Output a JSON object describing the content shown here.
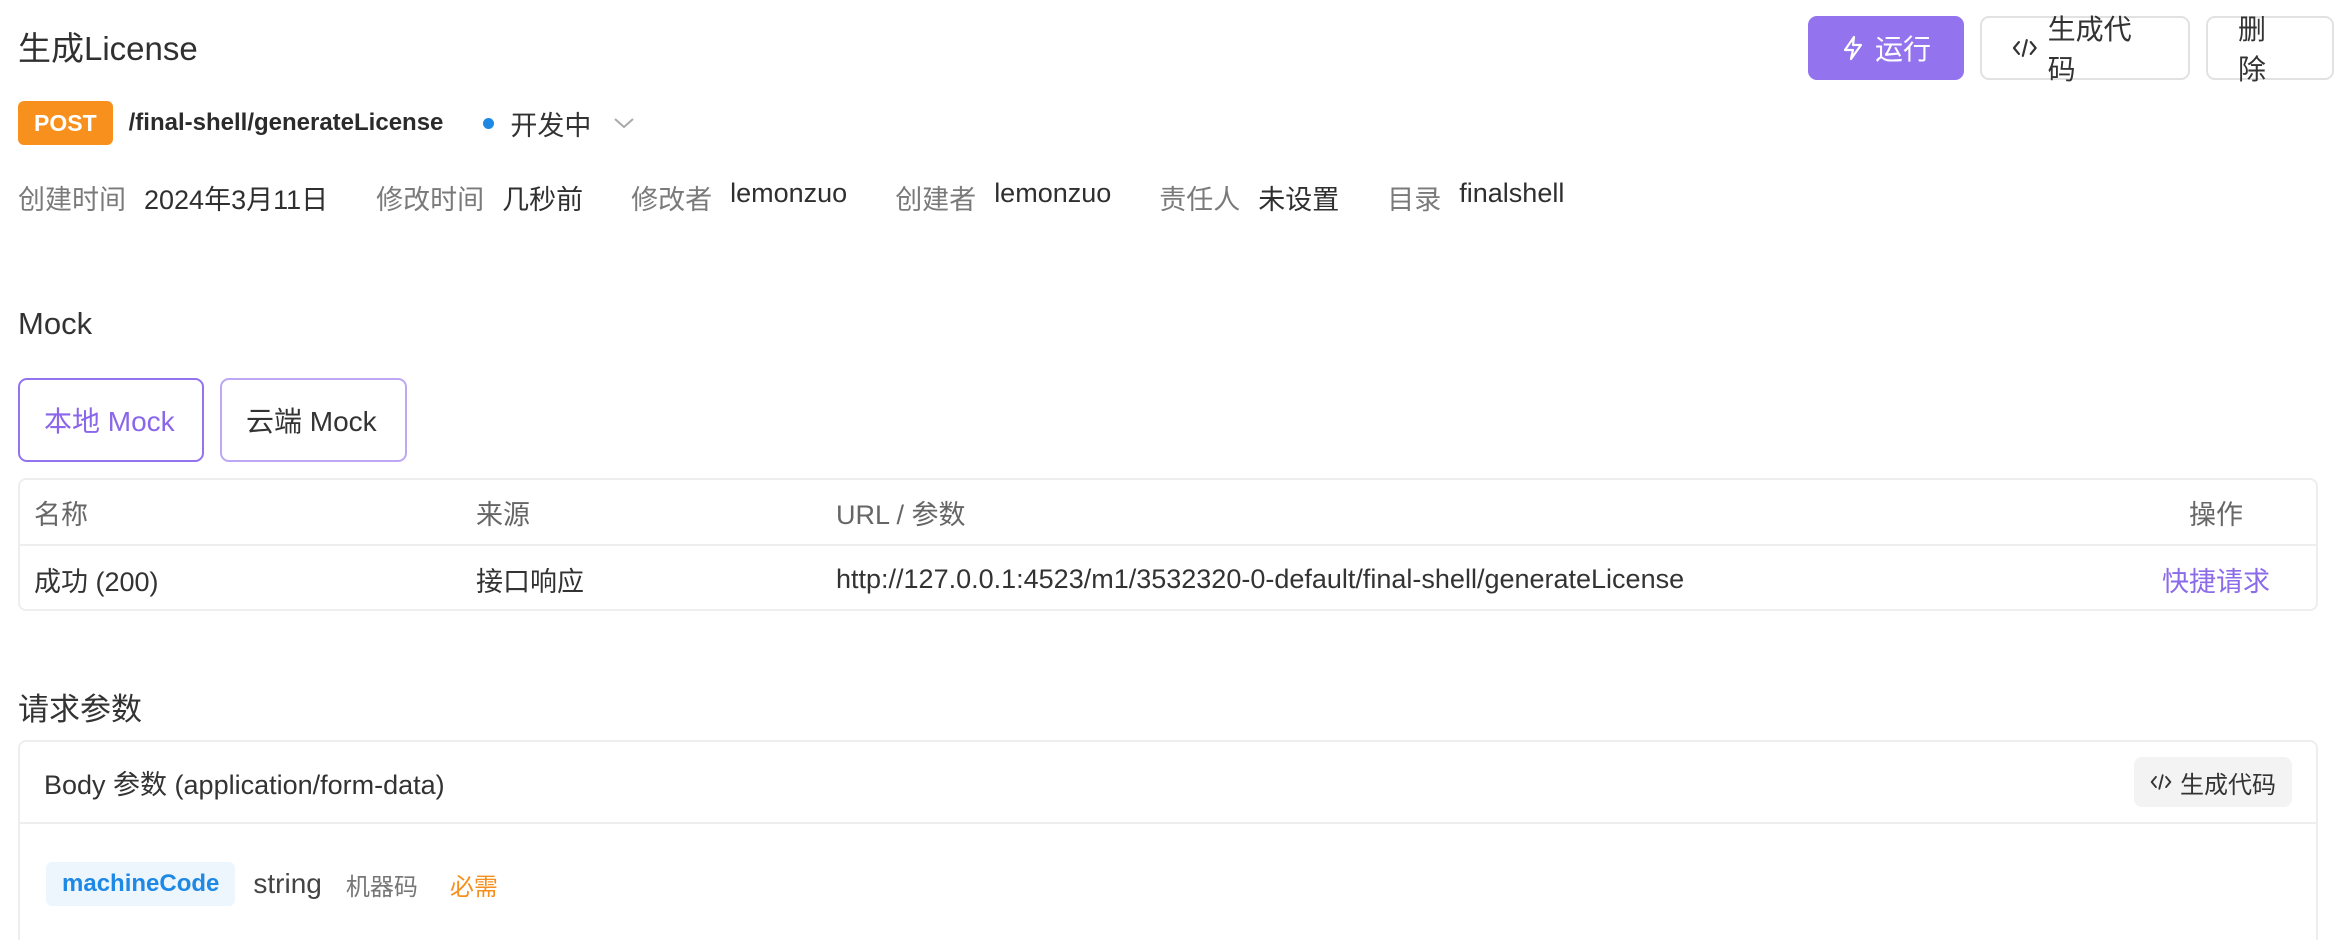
{
  "header": {
    "title": "生成License",
    "run_label": "运行",
    "gen_code_label": "生成代码",
    "delete_label": "删 除",
    "method": "POST",
    "path": "/final-shell/generateLicense",
    "status": "开发中"
  },
  "info": [
    {
      "label": "创建时间",
      "value": "2024年3月11日"
    },
    {
      "label": "修改时间",
      "value": "几秒前"
    },
    {
      "label": "修改者",
      "value": "lemonzuo"
    },
    {
      "label": "创建者",
      "value": "lemonzuo"
    },
    {
      "label": "责任人",
      "value": "未设置"
    },
    {
      "label": "目录",
      "value": "finalshell"
    }
  ],
  "mock": {
    "title": "Mock",
    "local_label": "本地 Mock",
    "cloud_label": "云端 Mock",
    "table": {
      "headers": [
        "名称",
        "来源",
        "URL / 参数",
        "操作"
      ],
      "row": {
        "name": "成功 (200)",
        "source": "接口响应",
        "url": "http://127.0.0.1:4523/m1/3532320-0-default/final-shell/generateLicense",
        "action": "快捷请求"
      }
    }
  },
  "request": {
    "title": "请求参数",
    "body_label": "Body 参数 (application/form-data)",
    "gen_code_label": "生成代码",
    "param": {
      "name": "machineCode",
      "type": "string",
      "desc": "机器码",
      "required": "必需"
    }
  }
}
